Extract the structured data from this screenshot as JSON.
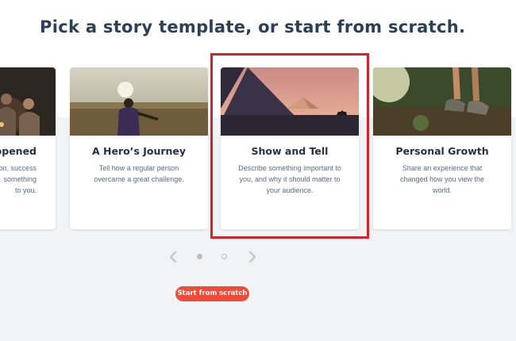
{
  "heading": "Pick a story template, or start from scratch.",
  "cards": [
    {
      "title": "ppened",
      "description": "tion, success\nsomething\nto you."
    },
    {
      "title": "A Hero’s Journey",
      "description": "Tell how a regular person\novercame a great challenge."
    },
    {
      "title": "Show and Tell",
      "description": "Describe something important to\nyou, and why it should matter to\nyour audience."
    },
    {
      "title": "Personal Growth",
      "description": "Share an experience that\nchanged how you view the\nworld."
    }
  ],
  "carousel": {
    "dot_count": 2,
    "active_index": 0
  },
  "start_button": {
    "label": "Start from scratch"
  },
  "colors": {
    "heading": "#2b3f55",
    "accent": "#ef4b3a",
    "highlight_box": "#d3242e",
    "background_band": "#f2f3f5"
  },
  "icons": {
    "prev": "chevron-left-icon",
    "next": "chevron-right-icon"
  }
}
